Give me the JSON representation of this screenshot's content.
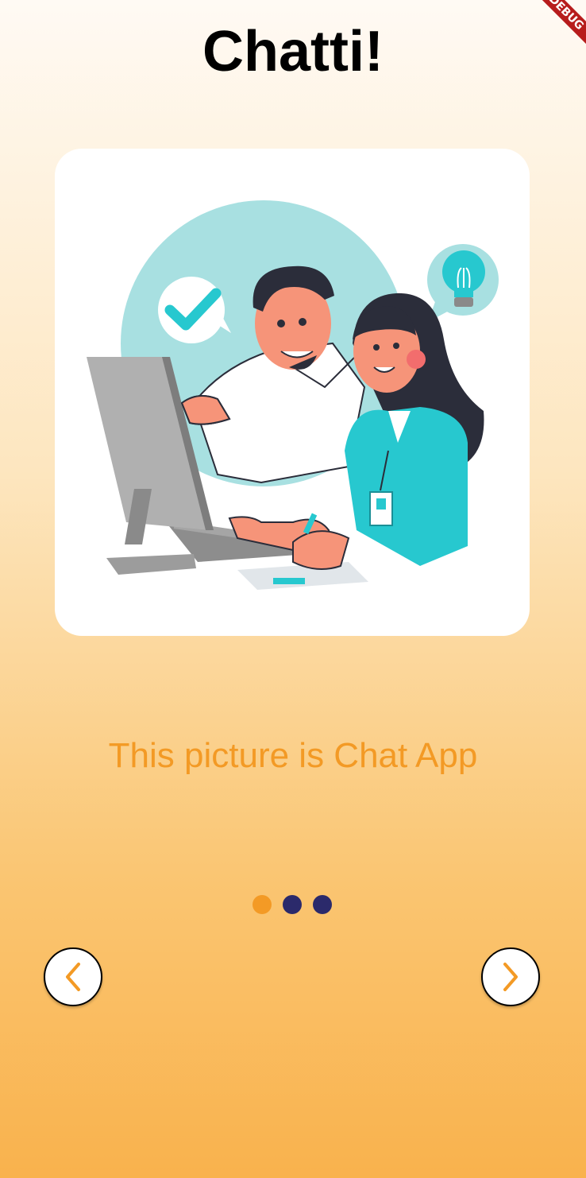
{
  "app": {
    "title": "Chatti!",
    "debug_banner": "DEBUG"
  },
  "onboarding": {
    "caption": "This picture is Chat App",
    "illustration": "two-people-at-computer-illustration",
    "page_indicator": {
      "current": 1,
      "total": 3
    }
  },
  "navigation": {
    "prev_icon": "chevron-left-icon",
    "next_icon": "chevron-right-icon"
  },
  "colors": {
    "accent": "#f39a25",
    "dot_inactive": "#2b2a6b",
    "teal": "#27c8cf",
    "gradient_top": "#fffaf4",
    "gradient_bottom": "#f9b24d"
  }
}
